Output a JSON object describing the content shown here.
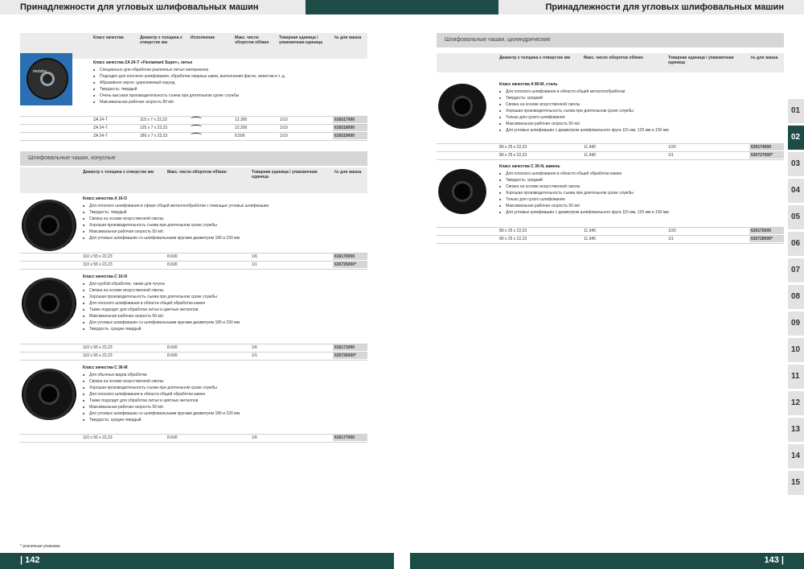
{
  "left_title": "Принадлежности для угловых шлифовальных машин",
  "right_title": "Принадлежности для угловых шлифовальных машин",
  "left_page": "| 142",
  "right_page": "143 |",
  "footnote": "* розничная упаковка",
  "table1": {
    "headers": [
      "Класс качества",
      "Диаметр х толщина х отверстие мм",
      "Исполнение",
      "Макс. число оборотов об/мин",
      "Товарная единица / упаковочная единица",
      "№ для заказа"
    ],
    "product_title": "Класс качества ZA 24-T «Flexiamant Super», литье",
    "bullets": [
      "Специально для обработки различных литых материалов",
      "Подходит для плоского шлифования, обработки сварных швов, выполнения фасок, зачистки и т. д.",
      "Абразивное зерно: циркониевый корунд",
      "Твердость: твердый",
      "Очень высокая производительность съема при длительном сроке службы",
      "Максимальная рабочая скорость 80 м/с"
    ],
    "rows": [
      {
        "cls": "ZA 24-T",
        "dim": "115 x 7 x 22,23",
        "rpm": "13.300",
        "pack": "1/10",
        "order": "616517000"
      },
      {
        "cls": "ZA 24-T",
        "dim": "125 x 7 x 22,23",
        "rpm": "12.200",
        "pack": "1/10",
        "order": "616518000"
      },
      {
        "cls": "ZA 24-T",
        "dim": "180 x 7 x 22,23",
        "rpm": "8.500",
        "pack": "1/10",
        "order": "616519000"
      }
    ]
  },
  "section2": {
    "title": "Шлифовальные чашки, конусные",
    "headers": [
      "Диаметр х толщина х отверстие мм",
      "Макс. число оборотов об/мин",
      "Товарная единица / упаковочная единица",
      "№ для заказа"
    ],
    "products": [
      {
        "title": "Класс качества A 16-O",
        "bullets": [
          "Для плоского шлифования в сфере общей металлообработки с помощью угловых шлифмашин",
          "Твердость: твердый",
          "Связка на основе искусственной смолы",
          "Хорошая производительность съема при длительном сроке службы",
          "Максимальная рабочая скорость 50 м/с",
          "Для угловых шлифмашин со шлифовальными кругами диаметром 180 и 230 мм"
        ],
        "rows": [
          {
            "dim": "110 x 55 x 22,23",
            "rpm": "8.600",
            "pack": "1/6",
            "order": "616170000"
          },
          {
            "dim": "110 x 55 x 22,23",
            "rpm": "8.600",
            "pack": "1/1",
            "order": "630725000*"
          }
        ]
      },
      {
        "title": "Класс качества C 16-N",
        "bullets": [
          "Для грубой обработки, также для чугуна",
          "Связка на основе искусственной смолы",
          "Хорошая производительность съема при длительном сроке службы",
          "Для плоского шлифования в области общей обработки камня",
          "Также подходит для обработки литья и цветных металлов",
          "Максимальная рабочая скорость 50 м/с",
          "Для угловых шлифмашин со шлифовальными кругами диаметром 180 и 230 мм",
          "Твердость: средне-твердый"
        ],
        "rows": [
          {
            "dim": "110 x 55 x 22,23",
            "rpm": "8.600",
            "pack": "1/6",
            "order": "616171000"
          },
          {
            "dim": "110 x 55 x 22,23",
            "rpm": "8.600",
            "pack": "1/1",
            "order": "630726000*"
          }
        ]
      },
      {
        "title": "Класс качества C 36-M",
        "bullets": [
          "Для обычных видов обработки",
          "Связка на основе искусственной смолы",
          "Хорошая производительность съема при длительном сроке службы",
          "Для плоского шлифования в области общей обработки камня",
          "Также подходит для обработки литья и цветных металлов",
          "Максимальная рабочая скорость 50 м/с",
          "Для угловых шлифмашин со шлифовальными кругами диаметром 180 и 230 мм",
          "Твердость: средне-твердый"
        ],
        "rows": [
          {
            "dim": "110 x 55 x 22,23",
            "rpm": "8.600",
            "pack": "1/6",
            "order": "616177000"
          }
        ]
      }
    ]
  },
  "section3": {
    "title": "Шлифовальные чашки, цилиндрические",
    "headers": [
      "Диаметр х толщина х отверстие мм",
      "Макс. число оборотов об/мин",
      "Товарная единица / упаковочная единица",
      "№ для заказа"
    ],
    "products": [
      {
        "title": "Класс качества A 80-M, сталь",
        "bullets": [
          "Для плоского шлифования в области общей металлообработки",
          "Твердость: средний",
          "Связка на основе искусственной смолы",
          "Хорошая производительность съема при длительном сроке службы",
          "Только для сухого шлифования",
          "Максимальная рабочая скорость 50 м/с",
          "Для угловых шлифмашин с диаметром шлифовального круга 115 мм, 125 мм и 150 мм"
        ],
        "rows": [
          {
            "dim": "80 x 25 x 22,23",
            "rpm": "11.940",
            "pack": "1/20",
            "order": "629174000"
          },
          {
            "dim": "80 x 25 x 22,23",
            "rpm": "11.940",
            "pack": "1/1",
            "order": "630727000*"
          }
        ]
      },
      {
        "title": "Класс качества C 30-N, камень",
        "bullets": [
          "Для плоского шлифования в области общей обработки камня",
          "Твердость: средний",
          "Связка на основе искусственной смолы",
          "Хорошая производительность съема при длительном сроке службы",
          "Только для сухого шлифования",
          "Максимальная рабочая скорость 50 м/с",
          "Для угловых шлифмашин с диаметром шлифовального круга 115 мм, 125 мм и 150 мм"
        ],
        "rows": [
          {
            "dim": "80 x 25 x 22,23",
            "rpm": "11.940",
            "pack": "1/20",
            "order": "629175000"
          },
          {
            "dim": "80 x 25 x 22,23",
            "rpm": "11.940",
            "pack": "1/1",
            "order": "630728000*"
          }
        ]
      }
    ]
  },
  "disc_label": "metabo",
  "tabs": [
    {
      "label": "01",
      "active": false
    },
    {
      "label": "02",
      "active": true
    },
    {
      "label": "03",
      "active": false
    },
    {
      "label": "04",
      "active": false
    },
    {
      "label": "05",
      "active": false
    },
    {
      "label": "06",
      "active": false
    },
    {
      "label": "07",
      "active": false
    },
    {
      "label": "08",
      "active": false
    },
    {
      "label": "09",
      "active": false
    },
    {
      "label": "10",
      "active": false
    },
    {
      "label": "11",
      "active": false
    },
    {
      "label": "12",
      "active": false
    },
    {
      "label": "13",
      "active": false
    },
    {
      "label": "14",
      "active": false
    },
    {
      "label": "15",
      "active": false
    }
  ]
}
